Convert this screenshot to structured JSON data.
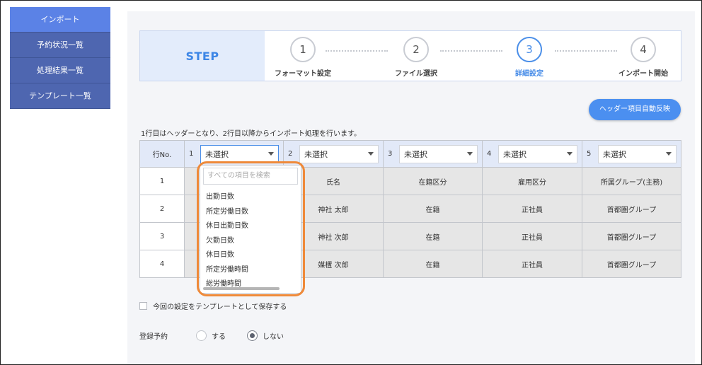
{
  "sidebar": {
    "items": [
      {
        "label": "インポート",
        "active": true
      },
      {
        "label": "予約状況一覧"
      },
      {
        "label": "処理結果一覧"
      },
      {
        "label": "テンプレート一覧"
      }
    ]
  },
  "stepper": {
    "title": "STEP",
    "current": 3,
    "steps": [
      {
        "number": "1",
        "label": "フォーマット設定"
      },
      {
        "number": "2",
        "label": "ファイル選択"
      },
      {
        "number": "3",
        "label": "詳細設定"
      },
      {
        "number": "4",
        "label": "インポート開始"
      }
    ]
  },
  "auto_header_button": "ヘッダー項目自動反映",
  "note": "1行目はヘッダーとなり、2行目以降からインポート処理を行います。",
  "table": {
    "row_no_header": "行No.",
    "columns": [
      {
        "num": "1",
        "select": "未選択"
      },
      {
        "num": "2",
        "select": "未選択"
      },
      {
        "num": "3",
        "select": "未選択"
      },
      {
        "num": "4",
        "select": "未選択"
      },
      {
        "num": "5",
        "select": "未選択"
      }
    ],
    "rows": [
      {
        "no": "1",
        "cells": [
          "",
          "氏名",
          "在籍区分",
          "雇用区分",
          "所属グループ(主務)"
        ]
      },
      {
        "no": "2",
        "cells": [
          "",
          "神社 太郎",
          "在籍",
          "正社員",
          "首都圏グループ"
        ]
      },
      {
        "no": "3",
        "cells": [
          "",
          "神社 次郎",
          "在籍",
          "正社員",
          "首都圏グループ"
        ]
      },
      {
        "no": "4",
        "cells": [
          "",
          "媒㯰 次郎",
          "在籍",
          "正社員",
          "首都圏グループ"
        ]
      }
    ]
  },
  "dropdown": {
    "search_placeholder": "すべての項目を検索",
    "items": [
      "出勤日数",
      "所定労働日数",
      "休日出勤日数",
      "欠勤日数",
      "休日日数",
      "所定労働時間",
      "総労働時間"
    ],
    "highlight_color": "#ef8a3a"
  },
  "save_template": {
    "label": "今回の設定をテンプレートとして保存する",
    "checked": false
  },
  "registration": {
    "label": "登録予約",
    "options": [
      {
        "label": "する",
        "selected": false
      },
      {
        "label": "しない",
        "selected": true
      }
    ]
  },
  "colors": {
    "accent": "#4b8ff0",
    "sidebar": "#4e66b0",
    "sidebar_active": "#5b82e6"
  }
}
